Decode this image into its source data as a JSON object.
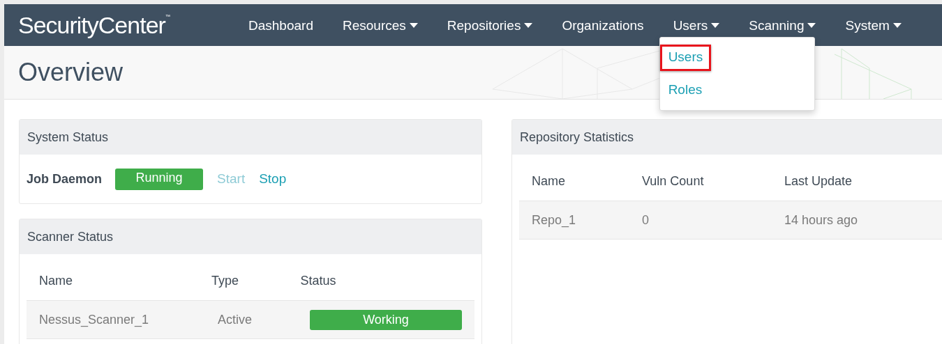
{
  "app": {
    "logo": "SecurityCenter",
    "trademark": "™"
  },
  "nav": [
    {
      "label": "Dashboard",
      "has_menu": false
    },
    {
      "label": "Resources",
      "has_menu": true
    },
    {
      "label": "Repositories",
      "has_menu": true
    },
    {
      "label": "Organizations",
      "has_menu": false
    },
    {
      "label": "Users",
      "has_menu": true,
      "menu": [
        {
          "label": "Users",
          "highlighted": true
        },
        {
          "label": "Roles",
          "highlighted": false
        }
      ]
    },
    {
      "label": "Scanning",
      "has_menu": true
    },
    {
      "label": "System",
      "has_menu": true
    }
  ],
  "page_title": "Overview",
  "system_status": {
    "title": "System Status",
    "label": "Job Daemon",
    "status": "Running",
    "actions": [
      {
        "label": "Start",
        "disabled": true
      },
      {
        "label": "Stop",
        "disabled": false
      }
    ]
  },
  "scanner_status": {
    "title": "Scanner Status",
    "columns": [
      "Name",
      "Type",
      "Status"
    ],
    "rows": [
      {
        "name": "Nessus_Scanner_1",
        "type": "Active",
        "status": "Working"
      }
    ]
  },
  "repository_statistics": {
    "title": "Repository Statistics",
    "columns": [
      "Name",
      "Vuln Count",
      "Last Update"
    ],
    "rows": [
      [
        "Repo_1",
        "0",
        "14 hours ago"
      ]
    ]
  }
}
